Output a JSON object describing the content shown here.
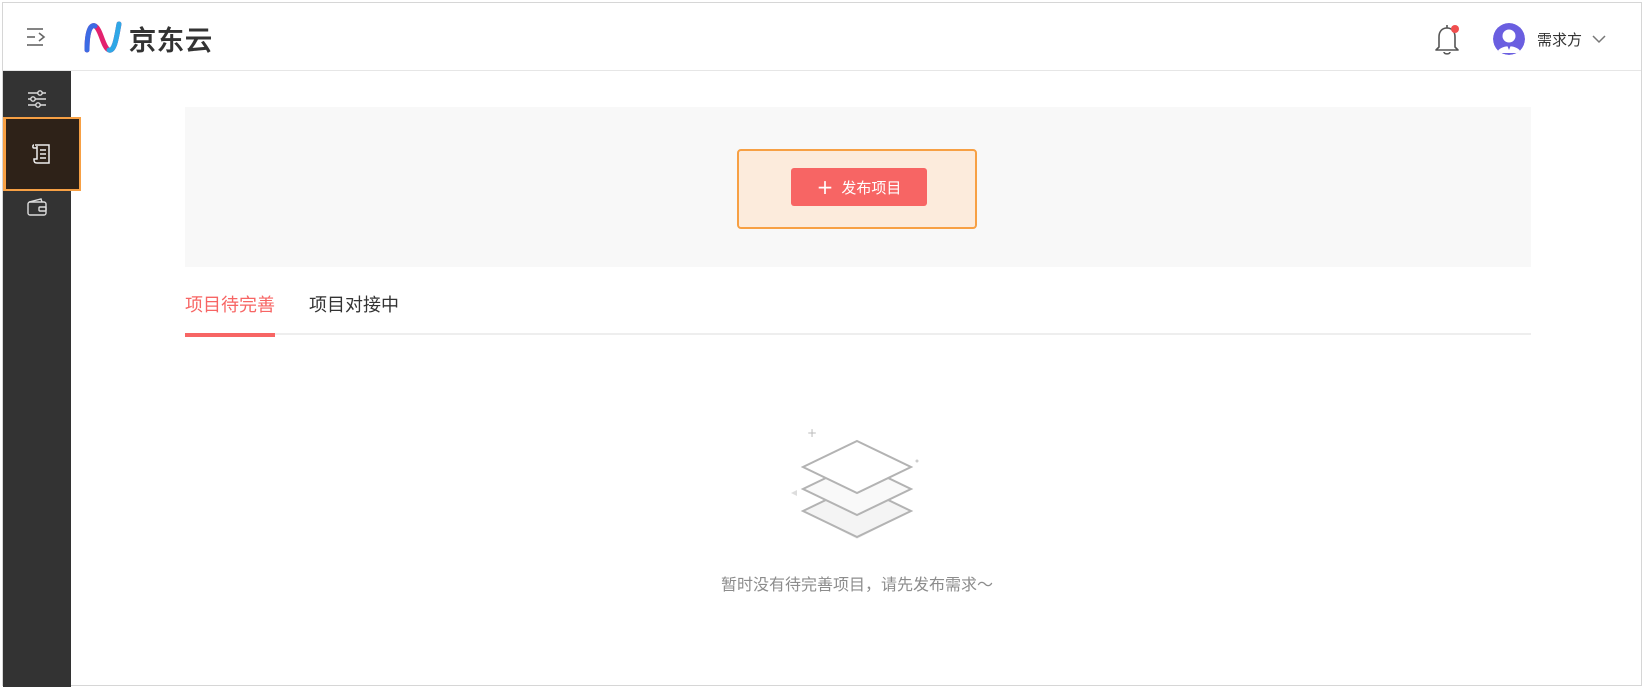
{
  "header": {
    "logo_text": "京东云",
    "user_name": "需求方",
    "notification_dot_color": "#f04e4e"
  },
  "sidebar": {
    "items": [
      {
        "icon": "sliders-icon",
        "active": false
      },
      {
        "icon": "document-list-icon",
        "active": true
      },
      {
        "icon": "wallet-icon",
        "active": false
      }
    ]
  },
  "main": {
    "publish_button_label": "发布项目",
    "tabs": [
      {
        "label": "项目待完善",
        "active": true
      },
      {
        "label": "项目对接中",
        "active": false
      }
    ],
    "empty_message": "暂时没有待完善项目，请先发布需求～"
  },
  "colors": {
    "accent": "#f76564",
    "highlight": "#f7a044",
    "sidebar_bg": "#333333"
  }
}
